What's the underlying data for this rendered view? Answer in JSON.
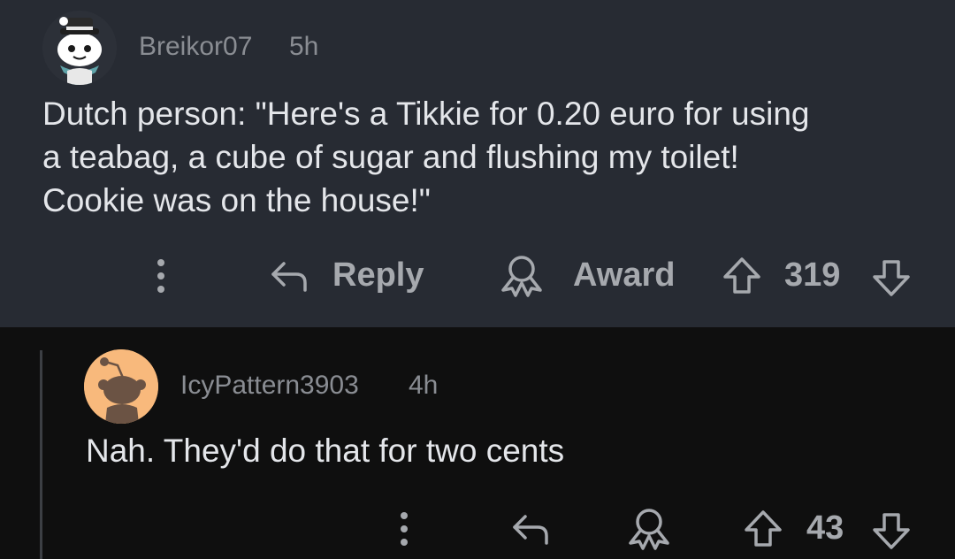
{
  "comments": [
    {
      "username": "Breikor07",
      "time": "5h",
      "avatar_icon": "snoo-avatar-hat-scarf",
      "lines": [
        "Dutch person: \"Here's a Tikkie for 0.20 euro for using",
        "a teabag, a cube of sugar and flushing my toilet!",
        "Cookie was on the house!\""
      ],
      "actions": {
        "more_icon": "more-vertical-icon",
        "reply_label": "Reply",
        "award_label": "Award",
        "score": "319"
      }
    },
    {
      "username": "IcyPattern3903",
      "time": "4h",
      "avatar_icon": "default-snoo-avatar",
      "text": "Nah. They'd do that for two cents",
      "actions": {
        "more_icon": "more-vertical-icon",
        "score": "43"
      }
    }
  ],
  "colors": {
    "highlight_bg": "#272b33",
    "page_bg": "#0f0f0f",
    "text": "#e4e6ea",
    "muted": "#8a8d93",
    "avatar_orange": "#f8b97c"
  }
}
